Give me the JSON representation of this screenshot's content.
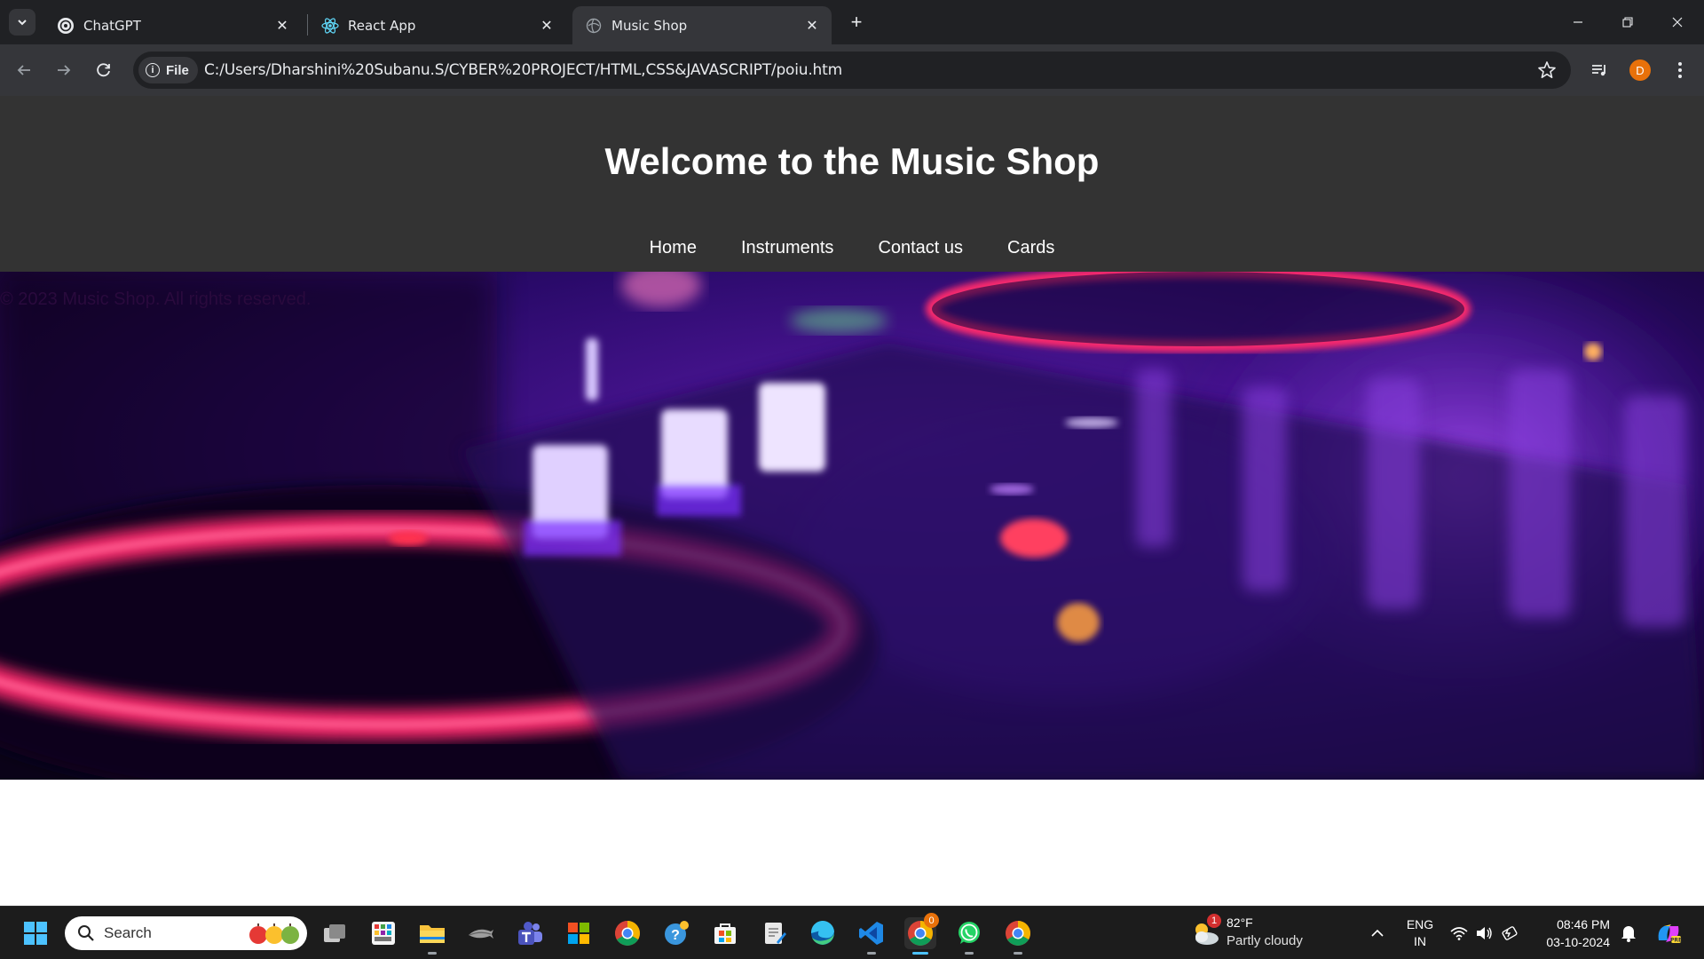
{
  "browser": {
    "tabs": [
      {
        "title": "ChatGPT",
        "icon": "chatgpt-icon",
        "active": false
      },
      {
        "title": "React App",
        "icon": "react-icon",
        "active": false
      },
      {
        "title": "Music Shop",
        "icon": "globe-icon",
        "active": true
      }
    ],
    "site_chip": "File",
    "url": "C:/Users/Dharshini%20Subanu.S/CYBER%20PROJECT/HTML,CSS&JAVASCRIPT/poiu.htm",
    "profile_initial": "D"
  },
  "site": {
    "title": "Welcome to the Music Shop",
    "nav": [
      "Home",
      "Instruments",
      "Contact us",
      "Cards"
    ],
    "footer": "© 2023 Music Shop. All rights reserved.",
    "colors": {
      "header_bg": "#333333",
      "accent_pink": "#ff2a6d",
      "accent_violet": "#7b2cff"
    }
  },
  "taskbar": {
    "search_placeholder": "Search",
    "weather": {
      "temp": "82°F",
      "condition": "Partly cloudy",
      "badge": "1"
    },
    "language": {
      "line1": "ENG",
      "line2": "IN"
    },
    "clock": {
      "time": "08:46 PM",
      "date": "03-10-2024"
    },
    "chrome_badge": "0"
  }
}
